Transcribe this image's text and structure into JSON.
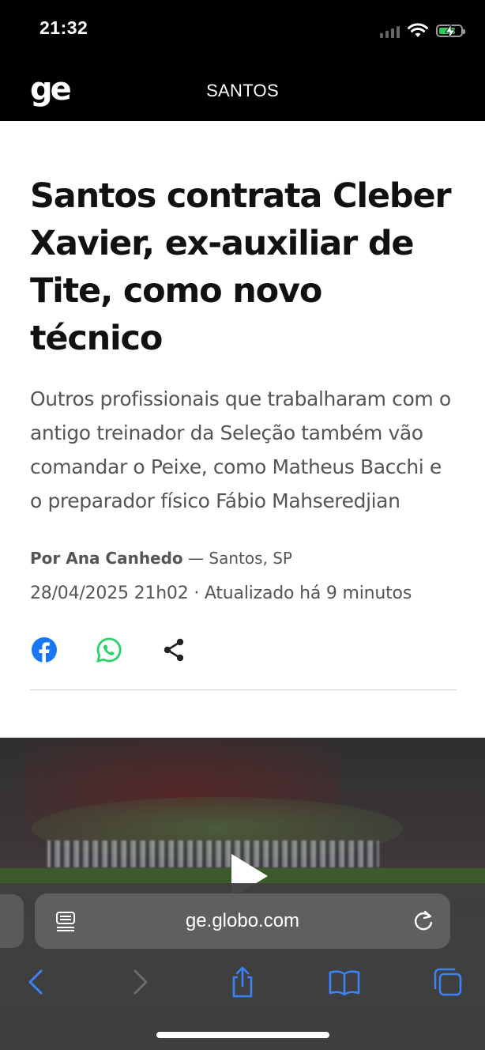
{
  "status_bar": {
    "time": "21:32",
    "icons": [
      "cellular-signal-icon",
      "wifi-icon",
      "battery-charging-icon"
    ],
    "battery_level": 0.75
  },
  "header": {
    "logo": "ge",
    "section": "SANTOS",
    "background": "#000000"
  },
  "article": {
    "headline": "Santos contrata Cleber Xavier, ex-auxiliar de Tite, como novo técnico",
    "subtitle": "Outros profissionais que trabalharam com o antigo treinador da Seleção também vão comandar o Peixe, como Matheus Bacchi e o preparador físico Fábio Mahseredjian",
    "byline_author": "Por Ana Canhedo",
    "byline_location": " — Santos, SP",
    "date": "28/04/2025 21h02 · Atualizado há 9 minutos",
    "share": [
      {
        "icon": "facebook-icon",
        "color": "#1877f2"
      },
      {
        "icon": "whatsapp-icon",
        "color": "#25d366"
      },
      {
        "icon": "share-icon",
        "color": "#222222"
      }
    ]
  },
  "video": {
    "icon": "play-icon"
  },
  "browser": {
    "url": "ge.globo.com",
    "accent": "#3b82f6",
    "toolbar": [
      "back-icon",
      "forward-icon",
      "share-icon",
      "bookmarks-icon",
      "tabs-icon"
    ]
  }
}
